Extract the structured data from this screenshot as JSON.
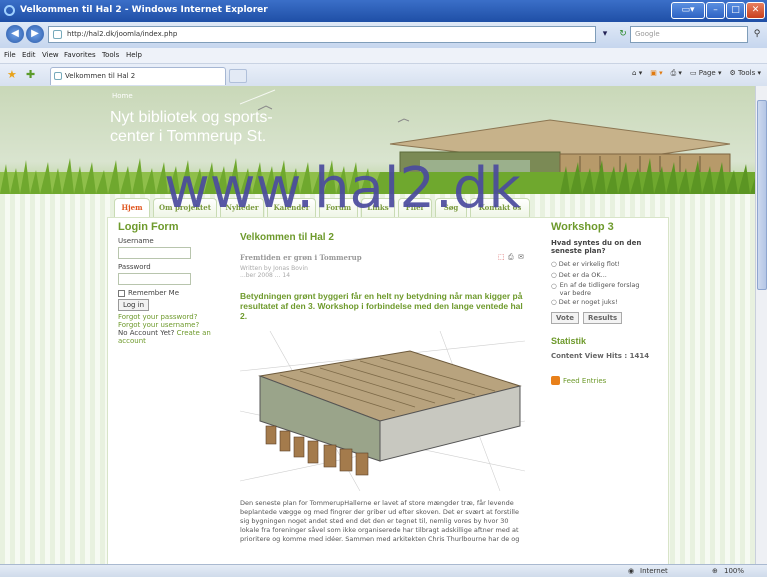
{
  "window": {
    "title": "Velkommen til Hal 2 - Windows Internet Explorer",
    "controls": [
      "minimize",
      "maximize",
      "close"
    ]
  },
  "addressbar": {
    "url": "http://hal2.dk/joomla/index.php",
    "search_placeholder": "Google"
  },
  "menubar": [
    "File",
    "Edit",
    "View",
    "Favorites",
    "Tools",
    "Help"
  ],
  "tabs": [
    {
      "label": "Velkommen til Hal 2"
    }
  ],
  "commandbar": {
    "page": "Page",
    "tools": "Tools"
  },
  "page": {
    "breadcrumb": "Home",
    "site_title": "Nyt bibliotek og sports-center i Tommerup St.",
    "nav": [
      "Hjem",
      "Om projektet",
      "Nyheder",
      "Kalender",
      "Forum",
      "Links",
      "Filer",
      "Søg",
      "Kontakt os"
    ],
    "login": {
      "heading": "Login Form",
      "username_label": "Username",
      "password_label": "Password",
      "remember_label": "Remember Me",
      "login_button": "Log in",
      "forgot_password": "Forgot your password?",
      "forgot_username": "Forgot your username?",
      "no_account": "No Account Yet?",
      "create_account": "Create an account"
    },
    "main": {
      "heading": "Velkommen til Hal 2",
      "article_title": "Fremtiden er grøn i Tommerup",
      "author": "Written by Jonas Bovin",
      "date": "...ber 2008 ... 14",
      "lead": "Betydningen grønt byggeri får en helt ny betydning når man kigger på resultatet af den 3. Workshop i forbindelse med den lange ventede hal 2.",
      "body": "Den seneste plan for TommerupHallerne er lavet af store mængder træ, får levende beplantede vægge og med fingrer der griber ud efter skoven. Det er svært at forstille sig bygningen noget andet sted end det den er tegnet til, nemlig vores by hvor 30 lokale fra foreninger såvel som ikke organiserede har tilbragt adskillige aftner med at prioritere og komme med idéer. Sammen med arkitekten Chris Thurlbourne har de og"
    },
    "poll": {
      "heading": "Workshop 3",
      "question": "Hvad syntes du on den seneste plan?",
      "options": [
        "Det er virkelig flot!",
        "Det er da OK...",
        "En af de tidligere forslag var bedre",
        "Det er noget juks!"
      ],
      "vote_button": "Vote",
      "results_button": "Results"
    },
    "stats": {
      "heading": "Statistik",
      "label": "Content View Hits :",
      "value": "1414"
    },
    "feed": "Feed Entries"
  },
  "watermark": "www.hal2.dk",
  "status": {
    "zone": "Internet",
    "zoom": "100%"
  },
  "colors": {
    "accent_green": "#6e9a2c",
    "active_tab": "#e0561e",
    "watermark": "#4b4b9e"
  }
}
